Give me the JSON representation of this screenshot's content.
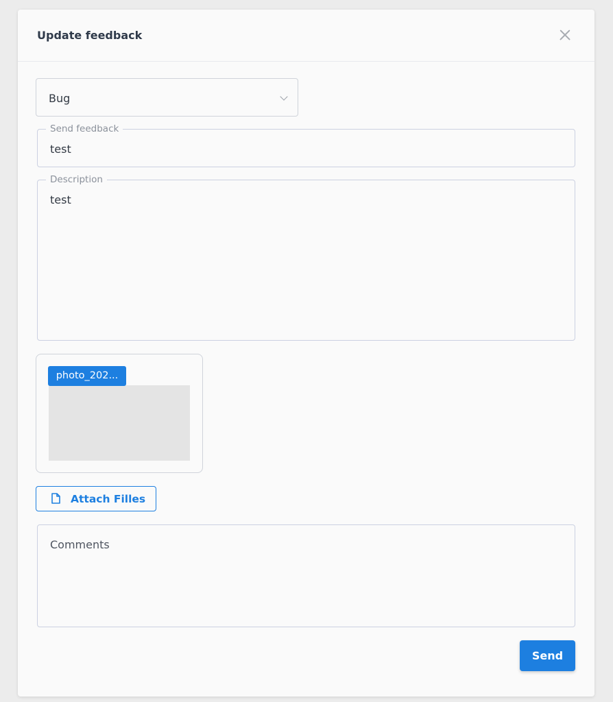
{
  "dialog": {
    "title": "Update feedback"
  },
  "category_select": {
    "value": "Bug"
  },
  "feedback_field": {
    "label": "Send feedback",
    "value": "test"
  },
  "description_field": {
    "label": "Description",
    "value": "test"
  },
  "attachment": {
    "file_name": "photo_202..."
  },
  "attach_button": {
    "label": "Attach Filles",
    "icon": "file-icon"
  },
  "comments_field": {
    "placeholder": "Comments"
  },
  "send_button": {
    "label": "Send"
  },
  "colors": {
    "accent": "#1d7fe0",
    "background": "#ececec",
    "panel": "#fafafa",
    "border": "#cbd0e1"
  }
}
